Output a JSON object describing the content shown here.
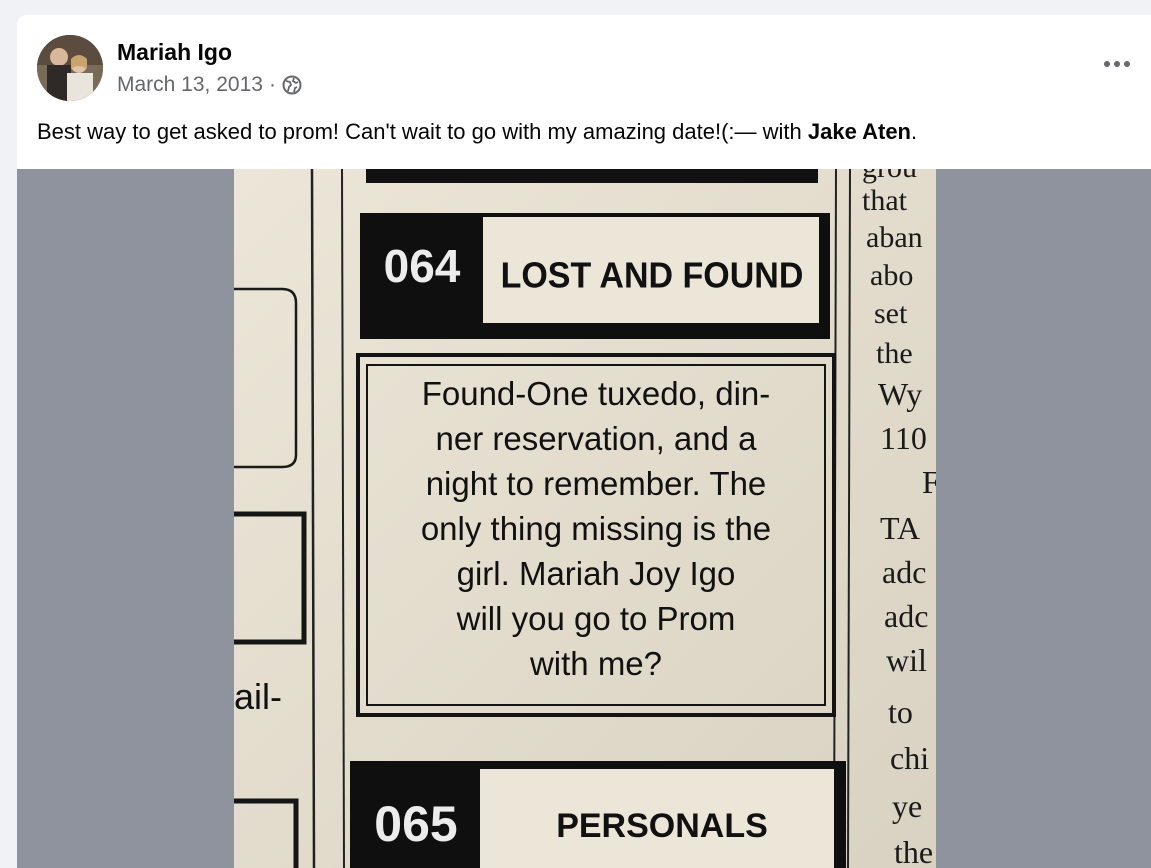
{
  "post": {
    "author": "Mariah Igo",
    "date": "March 13, 2013",
    "separator": "·",
    "caption_text": "Best way to get asked to prom! Can't wait to go with my amazing date!(:— with ",
    "tagged": "Jake Aten",
    "caption_end": "."
  },
  "icons": {
    "audience": "globe-icon",
    "menu": "more-options-icon"
  },
  "photo": {
    "section1_number": "064",
    "section1_title": "LOST AND FOUND",
    "ad_lines": [
      "Found-One tuxedo, din-",
      "ner reservation, and a",
      "night to remember.  The",
      "only thing missing is the",
      "girl.  Mariah Joy Igo",
      "will you go to Prom",
      "with me?"
    ],
    "left_fragment": "ail-",
    "section2_number": "065",
    "section2_title": "PERSONALS",
    "right_column": [
      "grou",
      "that",
      "aban",
      "abo",
      "set",
      "the",
      "Wy",
      "110",
      "F",
      "TA",
      "adc",
      "adc",
      "wil",
      "to",
      "chi",
      "ye",
      "the"
    ]
  },
  "colors": {
    "page_bg": "#f0f2f5",
    "text_primary": "#050505",
    "text_secondary": "#65676b",
    "media_bg": "#8e939d"
  }
}
